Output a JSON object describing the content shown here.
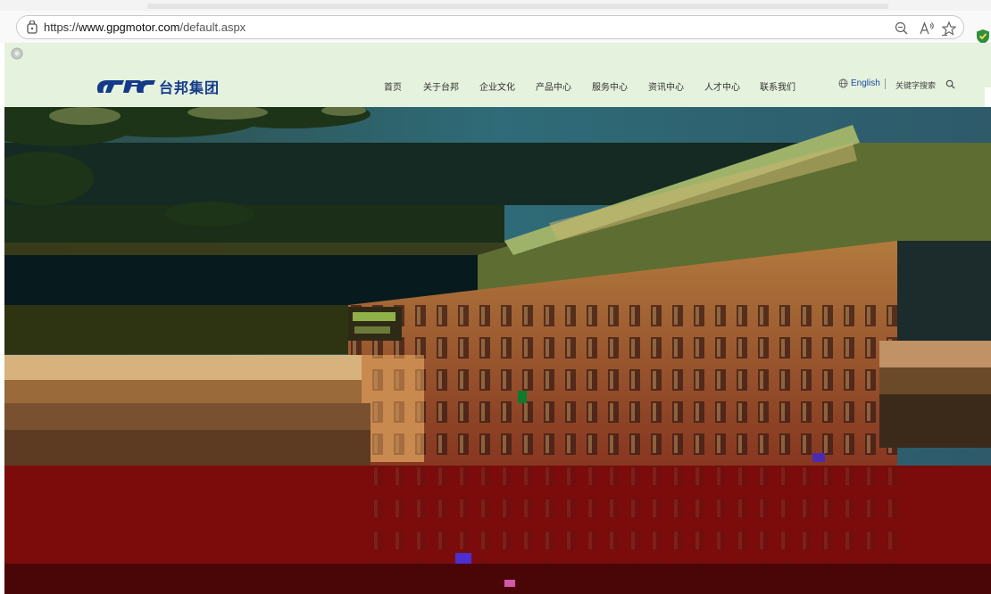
{
  "browser": {
    "url_prefix": "https://",
    "url_host": "www.gpgmotor.com",
    "url_path": "/default.aspx"
  },
  "icons": {
    "page_info": "page-info-icon",
    "zoom": "zoom-icon",
    "read_aloud": "read-aloud-icon",
    "favorite": "favorite-star-icon",
    "extension": "shield-extension-icon",
    "globe": "globe-icon",
    "search": "search-icon",
    "settings": "gear-icon"
  },
  "site": {
    "logo_text": "台邦集团",
    "nav": [
      {
        "label": "首页"
      },
      {
        "label": "关于台邦"
      },
      {
        "label": "企业文化"
      },
      {
        "label": "产品中心"
      },
      {
        "label": "服务中心"
      },
      {
        "label": "资讯中心"
      },
      {
        "label": "人才中心"
      },
      {
        "label": "联系我们"
      }
    ],
    "language_label": "English",
    "keyword_search_label": "关键字搜索"
  },
  "colors": {
    "header_bg": "#e5f2dd",
    "logo_blue": "#13398a",
    "english_link": "#1b4aa3"
  }
}
